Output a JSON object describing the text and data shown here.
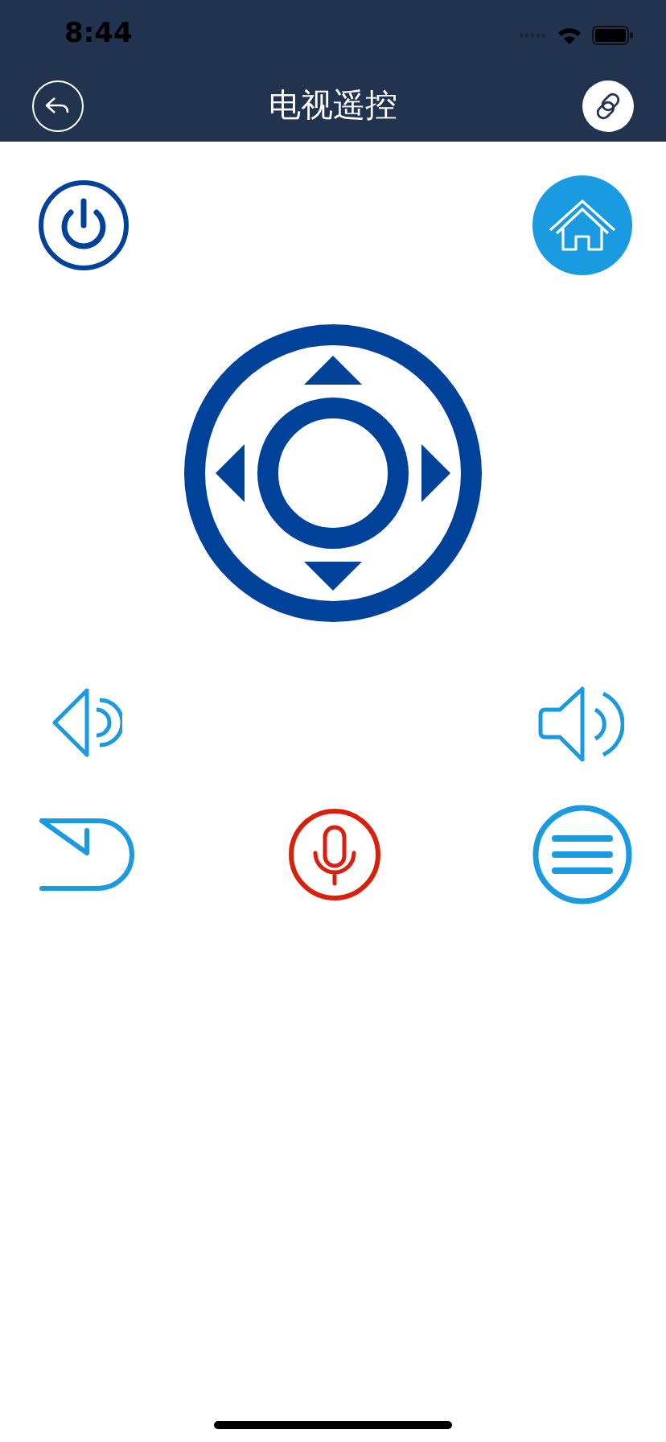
{
  "status_bar": {
    "time": "8:44"
  },
  "nav_bar": {
    "title": "电视遥控"
  }
}
